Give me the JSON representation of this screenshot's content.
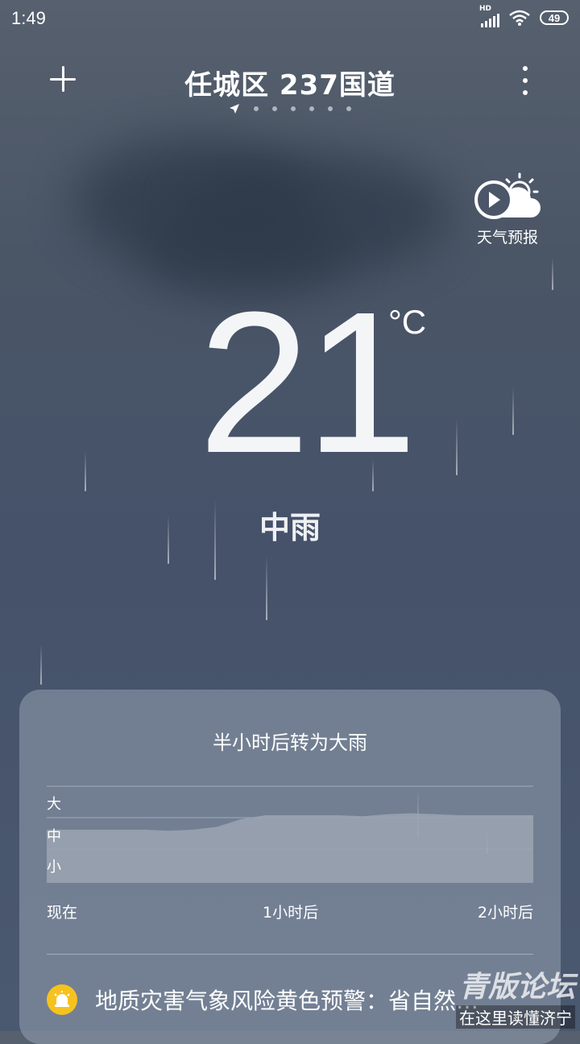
{
  "status_bar": {
    "time": "1:49",
    "network": "HD",
    "battery": "49"
  },
  "header": {
    "city": "任城区 237国道",
    "page_count": 7,
    "active_page": 0
  },
  "forecast_button": {
    "label": "天气预报",
    "icon": "play-cloud-sun-icon"
  },
  "current": {
    "temperature": "21",
    "unit": "°C",
    "condition": "中雨"
  },
  "precip_card": {
    "title": "半小时后转为大雨",
    "levels": [
      "大",
      "中",
      "小"
    ],
    "x_labels": [
      "现在",
      "1小时后",
      "2小时后"
    ],
    "intensity_series": [
      0.55,
      0.55,
      0.55,
      0.55,
      0.55,
      0.54,
      0.55,
      0.58,
      0.66,
      0.7,
      0.7,
      0.7,
      0.7,
      0.69,
      0.71,
      0.72,
      0.71,
      0.7,
      0.7,
      0.7,
      0.7
    ],
    "fill_color": "#9ba4b1"
  },
  "alert": {
    "text": "地质灾害气象风险黄色预警：省自然…",
    "icon": "alarm-bell-icon",
    "icon_color": "#f6c21e"
  },
  "watermark": {
    "top": "青版论坛",
    "bottom": "在这里读懂济宁"
  }
}
